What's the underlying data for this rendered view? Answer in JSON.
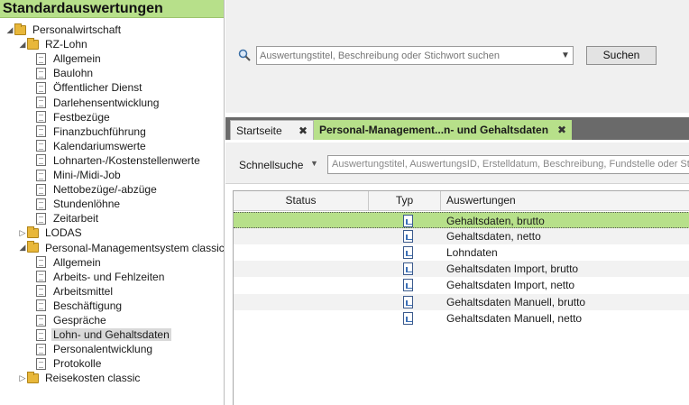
{
  "left_panel": {
    "title": "Standardauswertungen",
    "tree": [
      {
        "label": "Personalwirtschaft",
        "level": 0,
        "kind": "folder",
        "expanded": true
      },
      {
        "label": "RZ-Lohn",
        "level": 1,
        "kind": "folder",
        "expanded": true
      },
      {
        "label": "Allgemein",
        "level": 2,
        "kind": "doc"
      },
      {
        "label": "Baulohn",
        "level": 2,
        "kind": "doc"
      },
      {
        "label": "Öffentlicher Dienst",
        "level": 2,
        "kind": "doc"
      },
      {
        "label": "Darlehensentwicklung",
        "level": 2,
        "kind": "doc"
      },
      {
        "label": "Festbezüge",
        "level": 2,
        "kind": "doc"
      },
      {
        "label": "Finanzbuchführung",
        "level": 2,
        "kind": "doc"
      },
      {
        "label": "Kalendariumswerte",
        "level": 2,
        "kind": "doc"
      },
      {
        "label": "Lohnarten-/Kostenstellenwerte",
        "level": 2,
        "kind": "doc"
      },
      {
        "label": "Mini-/Midi-Job",
        "level": 2,
        "kind": "doc"
      },
      {
        "label": "Nettobezüge/-abzüge",
        "level": 2,
        "kind": "doc"
      },
      {
        "label": "Stundenlöhne",
        "level": 2,
        "kind": "doc"
      },
      {
        "label": "Zeitarbeit",
        "level": 2,
        "kind": "doc"
      },
      {
        "label": "LODAS",
        "level": 1,
        "kind": "folder",
        "expanded": false
      },
      {
        "label": "Personal-Managementsystem classic",
        "level": 1,
        "kind": "folder",
        "expanded": true
      },
      {
        "label": "Allgemein",
        "level": 2,
        "kind": "doc"
      },
      {
        "label": "Arbeits- und Fehlzeiten",
        "level": 2,
        "kind": "doc"
      },
      {
        "label": "Arbeitsmittel",
        "level": 2,
        "kind": "doc"
      },
      {
        "label": "Beschäftigung",
        "level": 2,
        "kind": "doc"
      },
      {
        "label": "Gespräche",
        "level": 2,
        "kind": "doc"
      },
      {
        "label": "Lohn- und Gehaltsdaten",
        "level": 2,
        "kind": "doc",
        "selected": true
      },
      {
        "label": "Personalentwicklung",
        "level": 2,
        "kind": "doc"
      },
      {
        "label": "Protokolle",
        "level": 2,
        "kind": "doc"
      },
      {
        "label": "Reisekosten classic",
        "level": 1,
        "kind": "folder",
        "expanded": false
      }
    ]
  },
  "search": {
    "placeholder": "Auswertungstitel, Beschreibung oder Stichwort suchen",
    "button_label": "Suchen"
  },
  "tabs": [
    {
      "label": "Startseite",
      "active": false,
      "close": "✖"
    },
    {
      "label": "Personal-Management...n- und Gehaltsdaten",
      "active": true,
      "close": "✖"
    }
  ],
  "filter": {
    "label": "Schnellsuche",
    "placeholder": "Auswertungstitel, AuswertungsID, Erstelldatum, Beschreibung, Fundstelle oder Stichw"
  },
  "grid": {
    "columns": [
      "Status",
      "Typ",
      "Auswertungen"
    ],
    "rows": [
      {
        "name": "Gehaltsdaten, brutto",
        "selected": true
      },
      {
        "name": "Gehaltsdaten, netto"
      },
      {
        "name": "Lohndaten"
      },
      {
        "name": "Gehaltsdaten Import, brutto"
      },
      {
        "name": "Gehaltsdaten Import, netto"
      },
      {
        "name": "Gehaltsdaten Manuell, brutto"
      },
      {
        "name": "Gehaltsdaten Manuell, netto"
      }
    ]
  },
  "colors": {
    "accent_green": "#b7e08a",
    "tabstrip": "#6a6a6a",
    "folder": "#e8b73a"
  }
}
